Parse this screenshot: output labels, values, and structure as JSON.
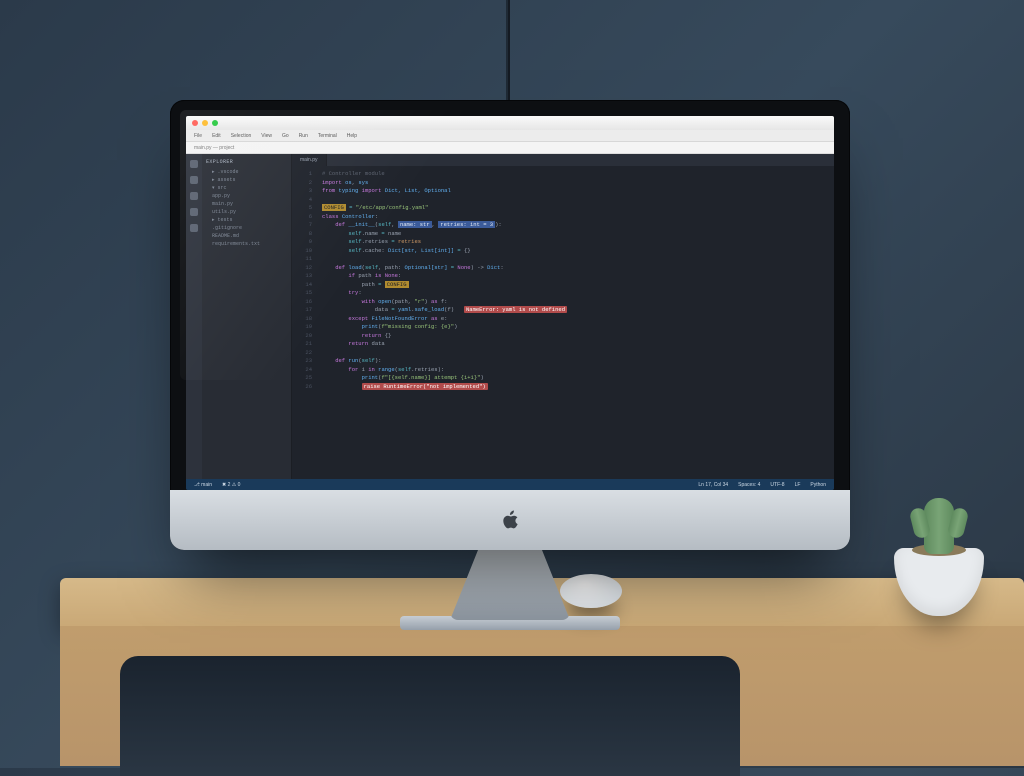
{
  "menubar": [
    "File",
    "Edit",
    "Selection",
    "View",
    "Go",
    "Run",
    "Terminal",
    "Help"
  ],
  "toolbar_hint": "main.py — project",
  "sidebar": {
    "header": "EXPLORER",
    "items": [
      "▸ .vscode",
      "▸ assets",
      "▾ src",
      "  app.py",
      "  main.py",
      "  utils.py",
      "▸ tests",
      ".gitignore",
      "README.md",
      "requirements.txt"
    ]
  },
  "tabs": [
    "main.py"
  ],
  "gutter_start": 1,
  "gutter_count": 26,
  "code_lines": [
    [
      {
        "c": "cmt",
        "t": "# Controller module"
      }
    ],
    [
      {
        "c": "kw",
        "t": "import"
      },
      {
        "t": " "
      },
      {
        "c": "fn",
        "t": "os"
      },
      {
        "t": ", "
      },
      {
        "c": "fn",
        "t": "sys"
      }
    ],
    [
      {
        "c": "kw",
        "t": "from"
      },
      {
        "t": " "
      },
      {
        "c": "fn",
        "t": "typing"
      },
      {
        "t": " "
      },
      {
        "c": "kw",
        "t": "import"
      },
      {
        "t": " "
      },
      {
        "c": "fn",
        "t": "Dict, List, Optional"
      }
    ],
    [],
    [
      {
        "c": "hl-y",
        "t": "CONFIG"
      },
      {
        "t": " "
      },
      {
        "c": "op",
        "t": "="
      },
      {
        "t": " "
      },
      {
        "c": "str",
        "t": "\"/etc/app/config.yaml\""
      }
    ],
    [
      {
        "c": "kw",
        "t": "class"
      },
      {
        "t": " "
      },
      {
        "c": "fn",
        "t": "Controller"
      },
      {
        "t": ":"
      }
    ],
    [
      {
        "t": "    "
      },
      {
        "c": "kw",
        "t": "def"
      },
      {
        "t": " "
      },
      {
        "c": "fn",
        "t": "__init__"
      },
      {
        "t": "("
      },
      {
        "c": "op",
        "t": "self"
      },
      {
        "t": ", "
      },
      {
        "c": "hl-b",
        "t": "name: str"
      },
      {
        "t": ", "
      },
      {
        "c": "hl-b",
        "t": "retries: int = 3"
      },
      {
        "t": "):"
      }
    ],
    [
      {
        "t": "        "
      },
      {
        "c": "op",
        "t": "self"
      },
      {
        "t": ".name "
      },
      {
        "c": "op",
        "t": "="
      },
      {
        "t": " name"
      }
    ],
    [
      {
        "t": "        "
      },
      {
        "c": "op",
        "t": "self"
      },
      {
        "t": ".retries "
      },
      {
        "c": "op",
        "t": "="
      },
      {
        "t": " "
      },
      {
        "c": "num",
        "t": "retries"
      }
    ],
    [
      {
        "t": "        "
      },
      {
        "c": "op",
        "t": "self"
      },
      {
        "t": ".cache: "
      },
      {
        "c": "fn",
        "t": "Dict[str, List[int]]"
      },
      {
        "t": " "
      },
      {
        "c": "op",
        "t": "="
      },
      {
        "t": " {}"
      }
    ],
    [],
    [
      {
        "t": "    "
      },
      {
        "c": "kw",
        "t": "def"
      },
      {
        "t": " "
      },
      {
        "c": "fn",
        "t": "load"
      },
      {
        "t": "("
      },
      {
        "c": "op",
        "t": "self"
      },
      {
        "t": ", path: "
      },
      {
        "c": "fn",
        "t": "Optional[str]"
      },
      {
        "t": " "
      },
      {
        "c": "op",
        "t": "="
      },
      {
        "t": " "
      },
      {
        "c": "kw",
        "t": "None"
      },
      {
        "t": ") -> "
      },
      {
        "c": "fn",
        "t": "Dict"
      },
      {
        "t": ":"
      }
    ],
    [
      {
        "t": "        "
      },
      {
        "c": "kw",
        "t": "if"
      },
      {
        "t": " path "
      },
      {
        "c": "kw",
        "t": "is"
      },
      {
        "t": " "
      },
      {
        "c": "kw",
        "t": "None"
      },
      {
        "t": ":"
      }
    ],
    [
      {
        "t": "            path "
      },
      {
        "c": "op",
        "t": "="
      },
      {
        "t": " "
      },
      {
        "c": "hl-y",
        "t": "CONFIG"
      }
    ],
    [
      {
        "t": "        "
      },
      {
        "c": "kw",
        "t": "try"
      },
      {
        "t": ":"
      }
    ],
    [
      {
        "t": "            "
      },
      {
        "c": "kw",
        "t": "with"
      },
      {
        "t": " "
      },
      {
        "c": "fn",
        "t": "open"
      },
      {
        "t": "(path, "
      },
      {
        "c": "str",
        "t": "\"r\""
      },
      {
        "t": ") "
      },
      {
        "c": "kw",
        "t": "as"
      },
      {
        "t": " f:"
      }
    ],
    [
      {
        "t": "                data "
      },
      {
        "c": "op",
        "t": "="
      },
      {
        "t": " "
      },
      {
        "c": "fn",
        "t": "yaml"
      },
      {
        "t": "."
      },
      {
        "c": "fn",
        "t": "safe_load"
      },
      {
        "t": "(f)   "
      },
      {
        "c": "err",
        "t": "NameError: yaml is not defined"
      }
    ],
    [
      {
        "t": "        "
      },
      {
        "c": "kw",
        "t": "except"
      },
      {
        "t": " "
      },
      {
        "c": "fn",
        "t": "FileNotFoundError"
      },
      {
        "t": " "
      },
      {
        "c": "kw",
        "t": "as"
      },
      {
        "t": " e:"
      }
    ],
    [
      {
        "t": "            "
      },
      {
        "c": "fn",
        "t": "print"
      },
      {
        "t": "("
      },
      {
        "c": "str",
        "t": "f\"missing config: {e}\""
      },
      {
        "t": ")"
      }
    ],
    [
      {
        "t": "            "
      },
      {
        "c": "kw",
        "t": "return"
      },
      {
        "t": " {}"
      }
    ],
    [
      {
        "t": "        "
      },
      {
        "c": "kw",
        "t": "return"
      },
      {
        "t": " data"
      }
    ],
    [],
    [
      {
        "t": "    "
      },
      {
        "c": "kw",
        "t": "def"
      },
      {
        "t": " "
      },
      {
        "c": "fn",
        "t": "run"
      },
      {
        "t": "("
      },
      {
        "c": "op",
        "t": "self"
      },
      {
        "t": "):"
      }
    ],
    [
      {
        "t": "        "
      },
      {
        "c": "kw",
        "t": "for"
      },
      {
        "t": " i "
      },
      {
        "c": "kw",
        "t": "in"
      },
      {
        "t": " "
      },
      {
        "c": "fn",
        "t": "range"
      },
      {
        "t": "("
      },
      {
        "c": "op",
        "t": "self"
      },
      {
        "t": ".retries):"
      }
    ],
    [
      {
        "t": "            "
      },
      {
        "c": "fn",
        "t": "print"
      },
      {
        "t": "("
      },
      {
        "c": "str",
        "t": "f\"[{self.name}] attempt {i+1}\""
      },
      {
        "t": ")"
      }
    ],
    [
      {
        "t": "            "
      },
      {
        "c": "err",
        "t": "raise RuntimeError(\"not implemented\")"
      }
    ]
  ],
  "status": {
    "branch": "main",
    "errors": "2",
    "warnings": "0",
    "position": "Ln 17, Col 34",
    "spaces": "Spaces: 4",
    "encoding": "UTF-8",
    "eol": "LF",
    "lang": "Python"
  }
}
